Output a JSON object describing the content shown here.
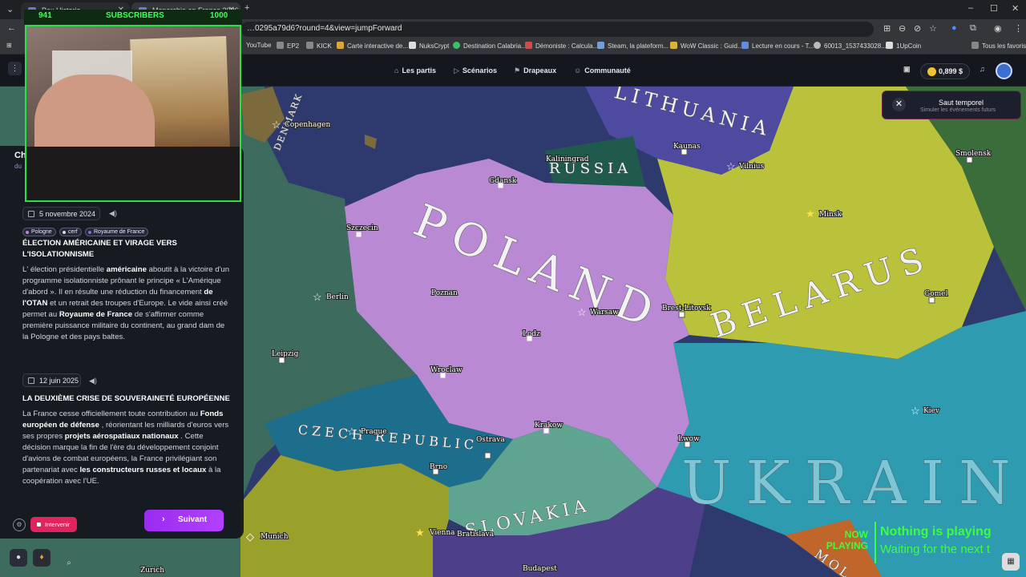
{
  "browser": {
    "tabs": [
      {
        "label": "Pax Historia"
      },
      {
        "label": "Monarchie en France 2026"
      }
    ],
    "url": "…0295a79d6?round=4&view=jumpForward",
    "bookmarks": [
      "YouTube",
      "EP2",
      "KICK",
      "Carte interactive de...",
      "NuksCrypt",
      "Destination Calabria...",
      "Démoniste : Calcula...",
      "Steam, la plateform...",
      "WoW Classic : Guid...",
      "Lecture en cours - T...",
      "60013_1537433028...",
      "1UpCoin"
    ],
    "all_favorites": "Tous les favoris"
  },
  "overlay": {
    "subs_current": "941",
    "subs_label": "SUBSCRIBERS",
    "subs_goal": "1000"
  },
  "header": {
    "nav": [
      {
        "label": "Les partis",
        "icon": "group-icon"
      },
      {
        "label": "Scénarios",
        "icon": "play-icon"
      },
      {
        "label": "Drapeaux",
        "icon": "flag-icon"
      },
      {
        "label": "Communauté",
        "icon": "users-icon"
      }
    ],
    "balance": "0,899 $"
  },
  "toast": {
    "title": "Saut temporel",
    "subtitle": "Simuler les événements futurs"
  },
  "panel": {
    "heading_fragment": "Ch",
    "sub_fragment": "du",
    "events": [
      {
        "date": "5 novembre 2024",
        "tags": [
          "Pologne",
          "cerf",
          "Royaume de France"
        ],
        "title": "ÉLECTION AMÉRICAINE ET VIRAGE VERS L'ISOLATIONNISME",
        "body_parts": [
          {
            "t": "L' élection présidentielle ",
            "b": false
          },
          {
            "t": "américaine",
            "b": true
          },
          {
            "t": " aboutit à la victoire d'un programme isolationniste prônant le principe « L'Amérique d'abord ». Il en résulte une réduction du financement ",
            "b": false
          },
          {
            "t": "de l'OTAN",
            "b": true
          },
          {
            "t": " et un retrait des troupes d'Europe. Le vide ainsi créé permet au ",
            "b": false
          },
          {
            "t": "Royaume de France",
            "b": true
          },
          {
            "t": " de s'affirmer comme première puissance militaire du continent, au grand dam de la Pologne et des pays baltes.",
            "b": false
          }
        ]
      },
      {
        "date": "12 juin 2025",
        "tags": [],
        "title": "LA DEUXIÈME CRISE DE SOUVERAINETÉ EUROPÉENNE",
        "body_parts": [
          {
            "t": "La France cesse officiellement toute contribution au ",
            "b": false
          },
          {
            "t": "Fonds européen de défense",
            "b": true
          },
          {
            "t": " , réorientant les milliards d'euros vers ses propres ",
            "b": false
          },
          {
            "t": "projets aérospatiaux nationaux",
            "b": true
          },
          {
            "t": " . Cette décision marque la fin de l'ère du développement conjoint d'avions de combat européens, la France privilégiant son partenariat avec ",
            "b": false
          },
          {
            "t": "les constructeurs russes et locaux",
            "b": true
          },
          {
            "t": " à la coopération avec l'UE.",
            "b": false
          }
        ]
      }
    ],
    "intervene_label": "Intervenir",
    "next_label": "Suivant"
  },
  "map": {
    "countries": [
      "LITHUANIA",
      "RUSSIA",
      "POLAND",
      "BELARUS",
      "CZECH REPUBLIC",
      "SLOVAKIA",
      "UKRAIN",
      "DENMARK",
      "MOL"
    ],
    "cities": [
      "Copenhagen",
      "Kaunas",
      "Vilnius",
      "Smolensk",
      "Kaliningrad",
      "Gdansk",
      "Szczecin",
      "Minsk",
      "Berlin",
      "Poznan",
      "Warsaw",
      "Brest-Litovsk",
      "Gomel",
      "Lodz",
      "Leipzig",
      "Wroclaw",
      "Kiev",
      "Prague",
      "Ostrava",
      "Krakow",
      "Lwow",
      "Brno",
      "Munich",
      "Vienna",
      "Bratislava",
      "Budapest",
      "Zurich"
    ]
  },
  "now_playing": {
    "label_1": "NOW",
    "label_2": "PLAYING",
    "title": "Nothing is playing",
    "subtitle": "Waiting for the next t"
  }
}
